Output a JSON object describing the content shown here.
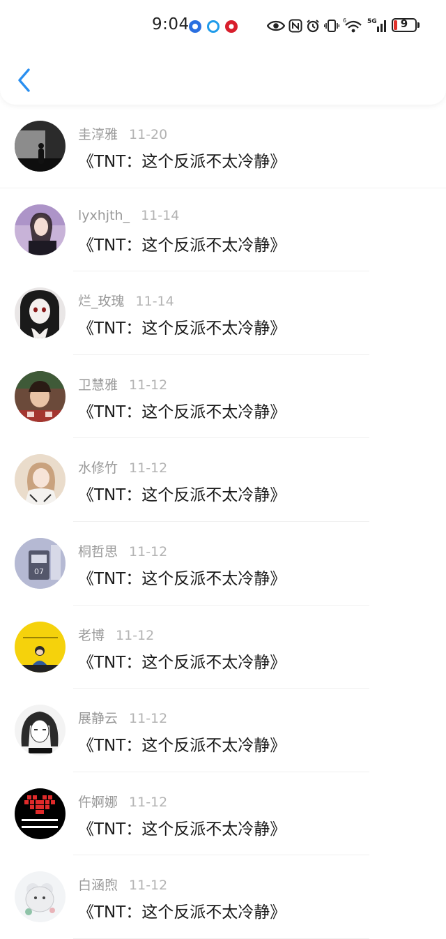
{
  "status_bar": {
    "time": "9:04",
    "battery_level": "9",
    "network": "5G",
    "icons": [
      "app-blue-icon",
      "app-ring-icon",
      "app-red-icon",
      "eye-icon",
      "nfc-icon",
      "alarm-icon",
      "vibrate-icon",
      "wifi-icon",
      "signal-icon",
      "battery-icon"
    ]
  },
  "header": {
    "back_icon": "chevron-left-icon",
    "accent_color": "#2a8ff0"
  },
  "items": [
    {
      "name": "圭淳雅",
      "date": "11-20",
      "title": "《TNT：这个反派不太冷静》"
    },
    {
      "name": "lyxhjth_",
      "date": "11-14",
      "title": "《TNT：这个反派不太冷静》"
    },
    {
      "name": "烂_玫瑰",
      "date": "11-14",
      "title": "《TNT：这个反派不太冷静》"
    },
    {
      "name": "卫慧雅",
      "date": "11-12",
      "title": "《TNT：这个反派不太冷静》"
    },
    {
      "name": "水修竹",
      "date": "11-12",
      "title": "《TNT：这个反派不太冷静》"
    },
    {
      "name": "桐哲思",
      "date": "11-12",
      "title": "《TNT：这个反派不太冷静》"
    },
    {
      "name": "老博",
      "date": "11-12",
      "title": "《TNT：这个反派不太冷静》"
    },
    {
      "name": "展静云",
      "date": "11-12",
      "title": "《TNT：这个反派不太冷静》"
    },
    {
      "name": "仵婀娜",
      "date": "11-12",
      "title": "《TNT：这个反派不太冷静》"
    },
    {
      "name": "白涵煦",
      "date": "11-12",
      "title": "《TNT：这个反派不太冷静》"
    }
  ]
}
